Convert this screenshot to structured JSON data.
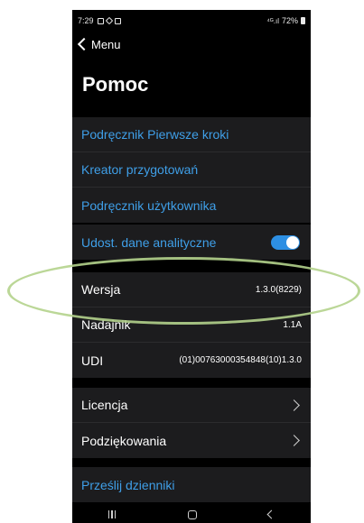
{
  "status_bar": {
    "time": "7:29",
    "signal": "⁴ᴳ.ıl",
    "battery": "72%"
  },
  "nav": {
    "back_label": "Menu"
  },
  "page_title": "Pomoc",
  "guides": [
    {
      "label": "Podręcznik Pierwsze kroki"
    },
    {
      "label": "Kreator przygotowań"
    },
    {
      "label": "Podręcznik użytkownika"
    }
  ],
  "analytics": {
    "label": "Udost. dane analityczne",
    "enabled": true
  },
  "info": [
    {
      "label": "Wersja",
      "value": "1.3.0(8229)"
    },
    {
      "label": "Nadajnik",
      "value": "1.1A"
    },
    {
      "label": "UDI",
      "value": "(01)00763000354848(10)1.3.0"
    }
  ],
  "legal": [
    {
      "label": "Licencja"
    },
    {
      "label": "Podziękowania"
    }
  ],
  "send_logs": {
    "label": "Prześlij dzienniki"
  },
  "colors": {
    "link": "#3f9fe8",
    "toggle_on": "#2d8fe3",
    "highlight": "#b4d38c"
  }
}
